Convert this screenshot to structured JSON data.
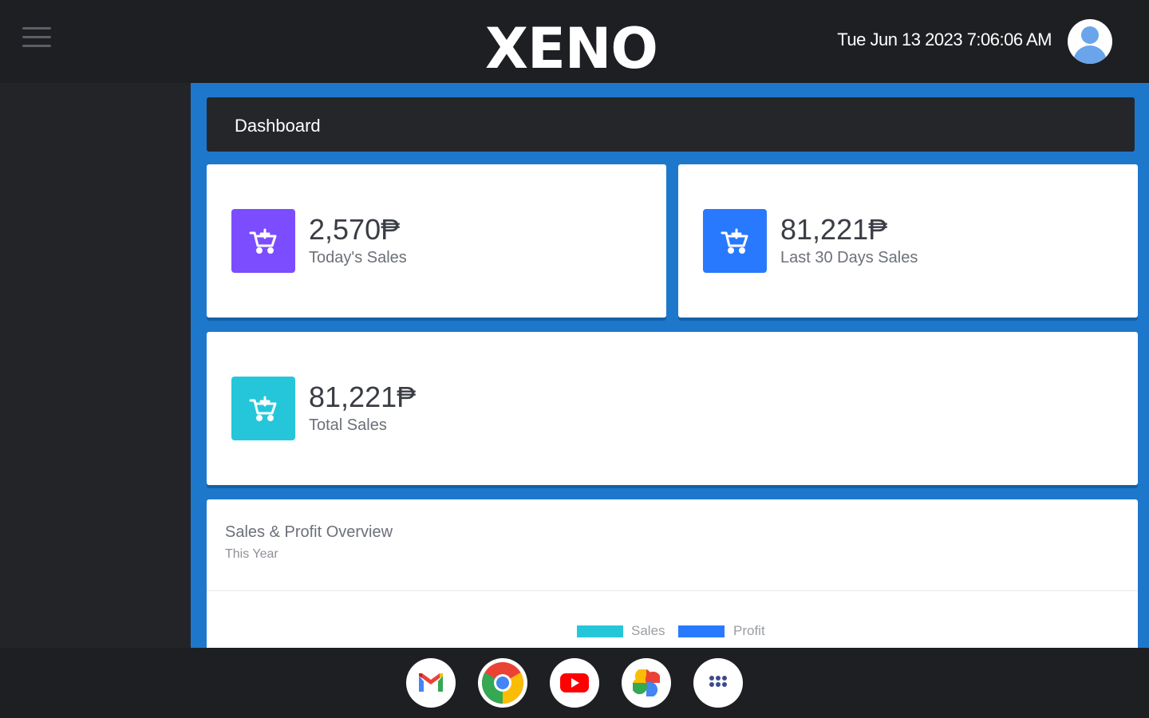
{
  "topbar": {
    "menu_icon": "hamburger-menu-icon",
    "logo_text": "XENO",
    "datetime": "Tue Jun 13 2023 7:06:06 AM",
    "avatar_icon": "user-avatar-icon"
  },
  "page": {
    "title": "Dashboard"
  },
  "stats": [
    {
      "value": "2,570₱",
      "label": "Today's Sales",
      "icon": "cart-plus-icon",
      "color": "#7c4dff"
    },
    {
      "value": "81,221₱",
      "label": "Last 30 Days Sales",
      "icon": "cart-plus-icon",
      "color": "#2979ff"
    },
    {
      "value": "81,221₱",
      "label": "Total Sales",
      "icon": "cart-plus-icon",
      "color": "#26c6da"
    }
  ],
  "chart": {
    "title": "Sales & Profit Overview",
    "subtitle": "This Year",
    "legend": [
      {
        "name": "Sales",
        "color": "#26c6da"
      },
      {
        "name": "Profit",
        "color": "#2979ff"
      }
    ]
  },
  "dock": {
    "apps": [
      {
        "name": "Gmail",
        "icon": "gmail-icon"
      },
      {
        "name": "Chrome",
        "icon": "chrome-icon"
      },
      {
        "name": "YouTube",
        "icon": "youtube-icon"
      },
      {
        "name": "Photos",
        "icon": "photos-icon"
      },
      {
        "name": "Apps",
        "icon": "app-launcher-icon"
      }
    ]
  },
  "colors": {
    "accent": "#1d78cc",
    "topbar": "#1e1f22",
    "sidebar": "#232428"
  }
}
